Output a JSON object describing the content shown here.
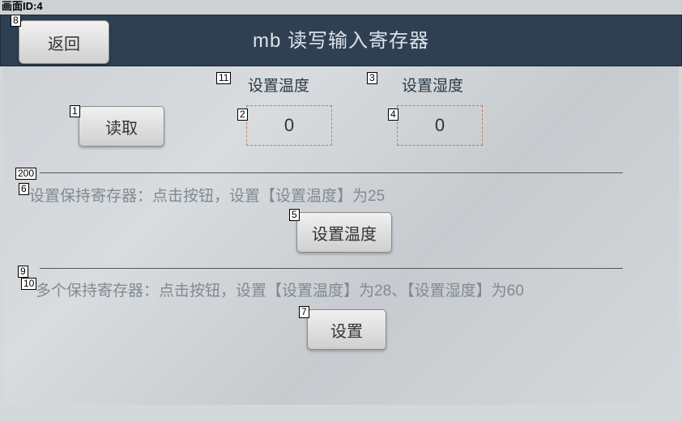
{
  "top_strip": "画面ID:4",
  "header": {
    "back_label": "返回",
    "title": "mb 读写输入寄存器"
  },
  "tags": {
    "t8": "8",
    "t11": "11",
    "t3": "3",
    "t1": "1",
    "t2": "2",
    "t4": "4",
    "t200": "200",
    "t6": "6",
    "t5": "5",
    "t9": "9",
    "t10": "10",
    "t7": "7"
  },
  "labels": {
    "set_temp": "设置温度",
    "set_humid": "设置湿度"
  },
  "buttons": {
    "read": "读取",
    "set_temp_btn": "设置温度",
    "set_btn": "设置"
  },
  "values": {
    "temp_val": "0",
    "humid_val": "0"
  },
  "instructions": {
    "line1_a": "设置保持寄存器：点击按钮，设置【设置温度】为25",
    "line2_a": "多个保持寄存器：点击按钮，设置【设置温度】为28、【设置湿度】为60"
  }
}
